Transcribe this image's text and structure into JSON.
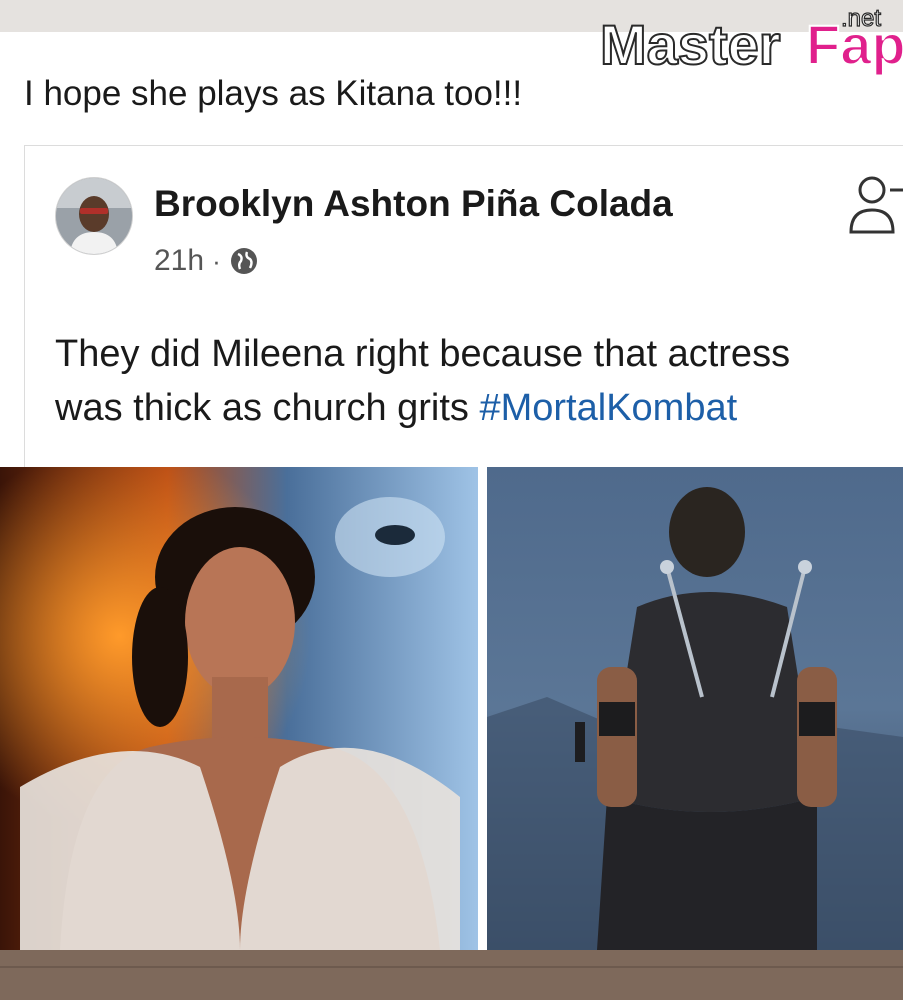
{
  "watermark": {
    "brand": "MasterFap",
    "brand_part1": "Master",
    "brand_part2": "Fap",
    "tld": ".net"
  },
  "caption": "I hope she plays as Kitana too!!!",
  "post": {
    "author": "Brooklyn Ashton Piña Colada",
    "time": "21h",
    "separator": "·",
    "privacy_icon": "globe-icon",
    "action_icon": "add-friend-icon",
    "text_line1": "They did Mileena right because that actress",
    "text_line2": "was thick as church grits",
    "hashtag": "#MortalKombat"
  },
  "colors": {
    "hashtag": "#1d5fa8",
    "watermark_fap": "#e0208c",
    "bottom_bar": "#7e695b"
  }
}
